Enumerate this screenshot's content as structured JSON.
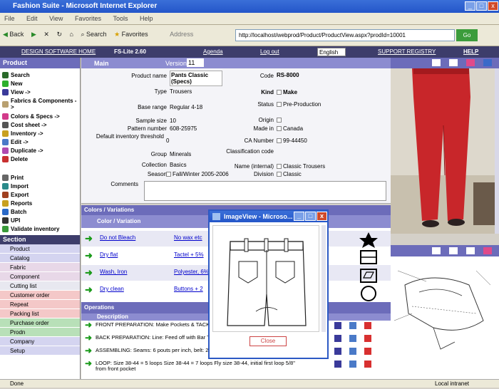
{
  "window": {
    "title": "Fashion Suite - Microsoft Internet Explorer",
    "min": "_",
    "max": "□",
    "close": "x"
  },
  "menu": [
    "File",
    "Edit",
    "View",
    "Favorites",
    "Tools",
    "Help"
  ],
  "toolbar": {
    "back": "Back",
    "search": "Search",
    "favorites": "Favorites",
    "address_label": "Address",
    "address": "http://localhost/webprod/Product/ProductView.aspx?prodId=10001",
    "go": "Go"
  },
  "appnav": {
    "item1": "DESIGN SOFTWARE HOME",
    "item2": "FS-Lite 2.60",
    "item3": "Agenda",
    "item4": "Log out",
    "lang": "English",
    "item5": "SUPPORT REGISTRY",
    "item6": "HELP"
  },
  "left": {
    "header": "Product",
    "actions": [
      "Search",
      "New",
      "View ->",
      "Fabrics & Components ->",
      "Colors & Specs ->",
      "Cost sheet ->",
      "Inventory ->",
      "Edit ->",
      "Duplicate ->",
      "Delete"
    ],
    "actions2": [
      "Print",
      "Import",
      "Export",
      "Reports",
      "Batch",
      "UPI",
      "Validate inventory"
    ],
    "section": "Section",
    "sections": [
      "Product",
      "Catalog",
      "Fabric",
      "Component",
      "Cutting list",
      "Customer order",
      "Repeat",
      "Packing list",
      "Purchase order",
      "Prodn",
      "Company",
      "Setup"
    ]
  },
  "form": {
    "product_name_label": "Product name",
    "product_name": "Pants Classic (Specs)",
    "code_label": "Code",
    "code": "RS-8000",
    "type_label": "Type",
    "type": "Trousers",
    "kind_label": "Kind",
    "kind": "Make",
    "base_range_label": "Base range",
    "base_range": "Regular 4-18",
    "status_label": "Status",
    "status": "Pre-Production",
    "sample_size_label": "Sample size",
    "sample_size": "10",
    "origin_label": "Origin",
    "pattern_label": "Pattern number",
    "pattern": "608-25975",
    "made_in_label": "Made in",
    "made_in": "Canada",
    "threshold_label": "Default inventory threshold",
    "threshold": "0",
    "ca_label": "CA Number",
    "ca": "99-44450",
    "group_label": "Group",
    "group": "Minerals",
    "classification_label": "Classification code",
    "collection_label": "Collection",
    "collection": "Basics",
    "name_internal_label": "Name (internal)",
    "name_internal": "Classic Trousers",
    "season_label": "Season",
    "season": "Fall/Winter 2005-2006",
    "division_label": "Division",
    "division": "Classic",
    "comments_label": "Comments",
    "header_tab": "Main",
    "header_field": "Version",
    "header_value": "11"
  },
  "colors": {
    "header": "Colors / Variations",
    "sub": "Color / Variation",
    "rows": [
      {
        "a": "Do not Bleach",
        "b": "No wax etc"
      },
      {
        "a": "Dry flat",
        "b": "Tactel + 5%"
      },
      {
        "a": "Wash, Iron",
        "b": "Polyester, 6%"
      },
      {
        "a": "Dry clean",
        "b": "Buttons + 2"
      }
    ]
  },
  "operations": {
    "header": "Operations",
    "sub": "Description",
    "rows": [
      "FRONT PREPARATION: Make Pockets & TACK ON FLY",
      "BACK PREPARATION: Line: Feed off with Bar Tack on pockets",
      "ASSEMBLING: Seams: 6 pouts per inch, belt: 2 needles",
      "LOOP: Size 38-44 = 5 loops Size 38-44 = 7 loops Fly size 38-44, initial first loop 5/8\" from front pocket"
    ]
  },
  "popup": {
    "title": "ImageView - Microso...",
    "close_label": "Close"
  },
  "status": {
    "left": "Done",
    "right": "Local intranet"
  },
  "colors_map": {
    "nav": "#3d3d6b",
    "panel": "#6c6cba",
    "sub": "#8c8cd0",
    "link": "#0000cc",
    "pants": "#c8262a"
  }
}
